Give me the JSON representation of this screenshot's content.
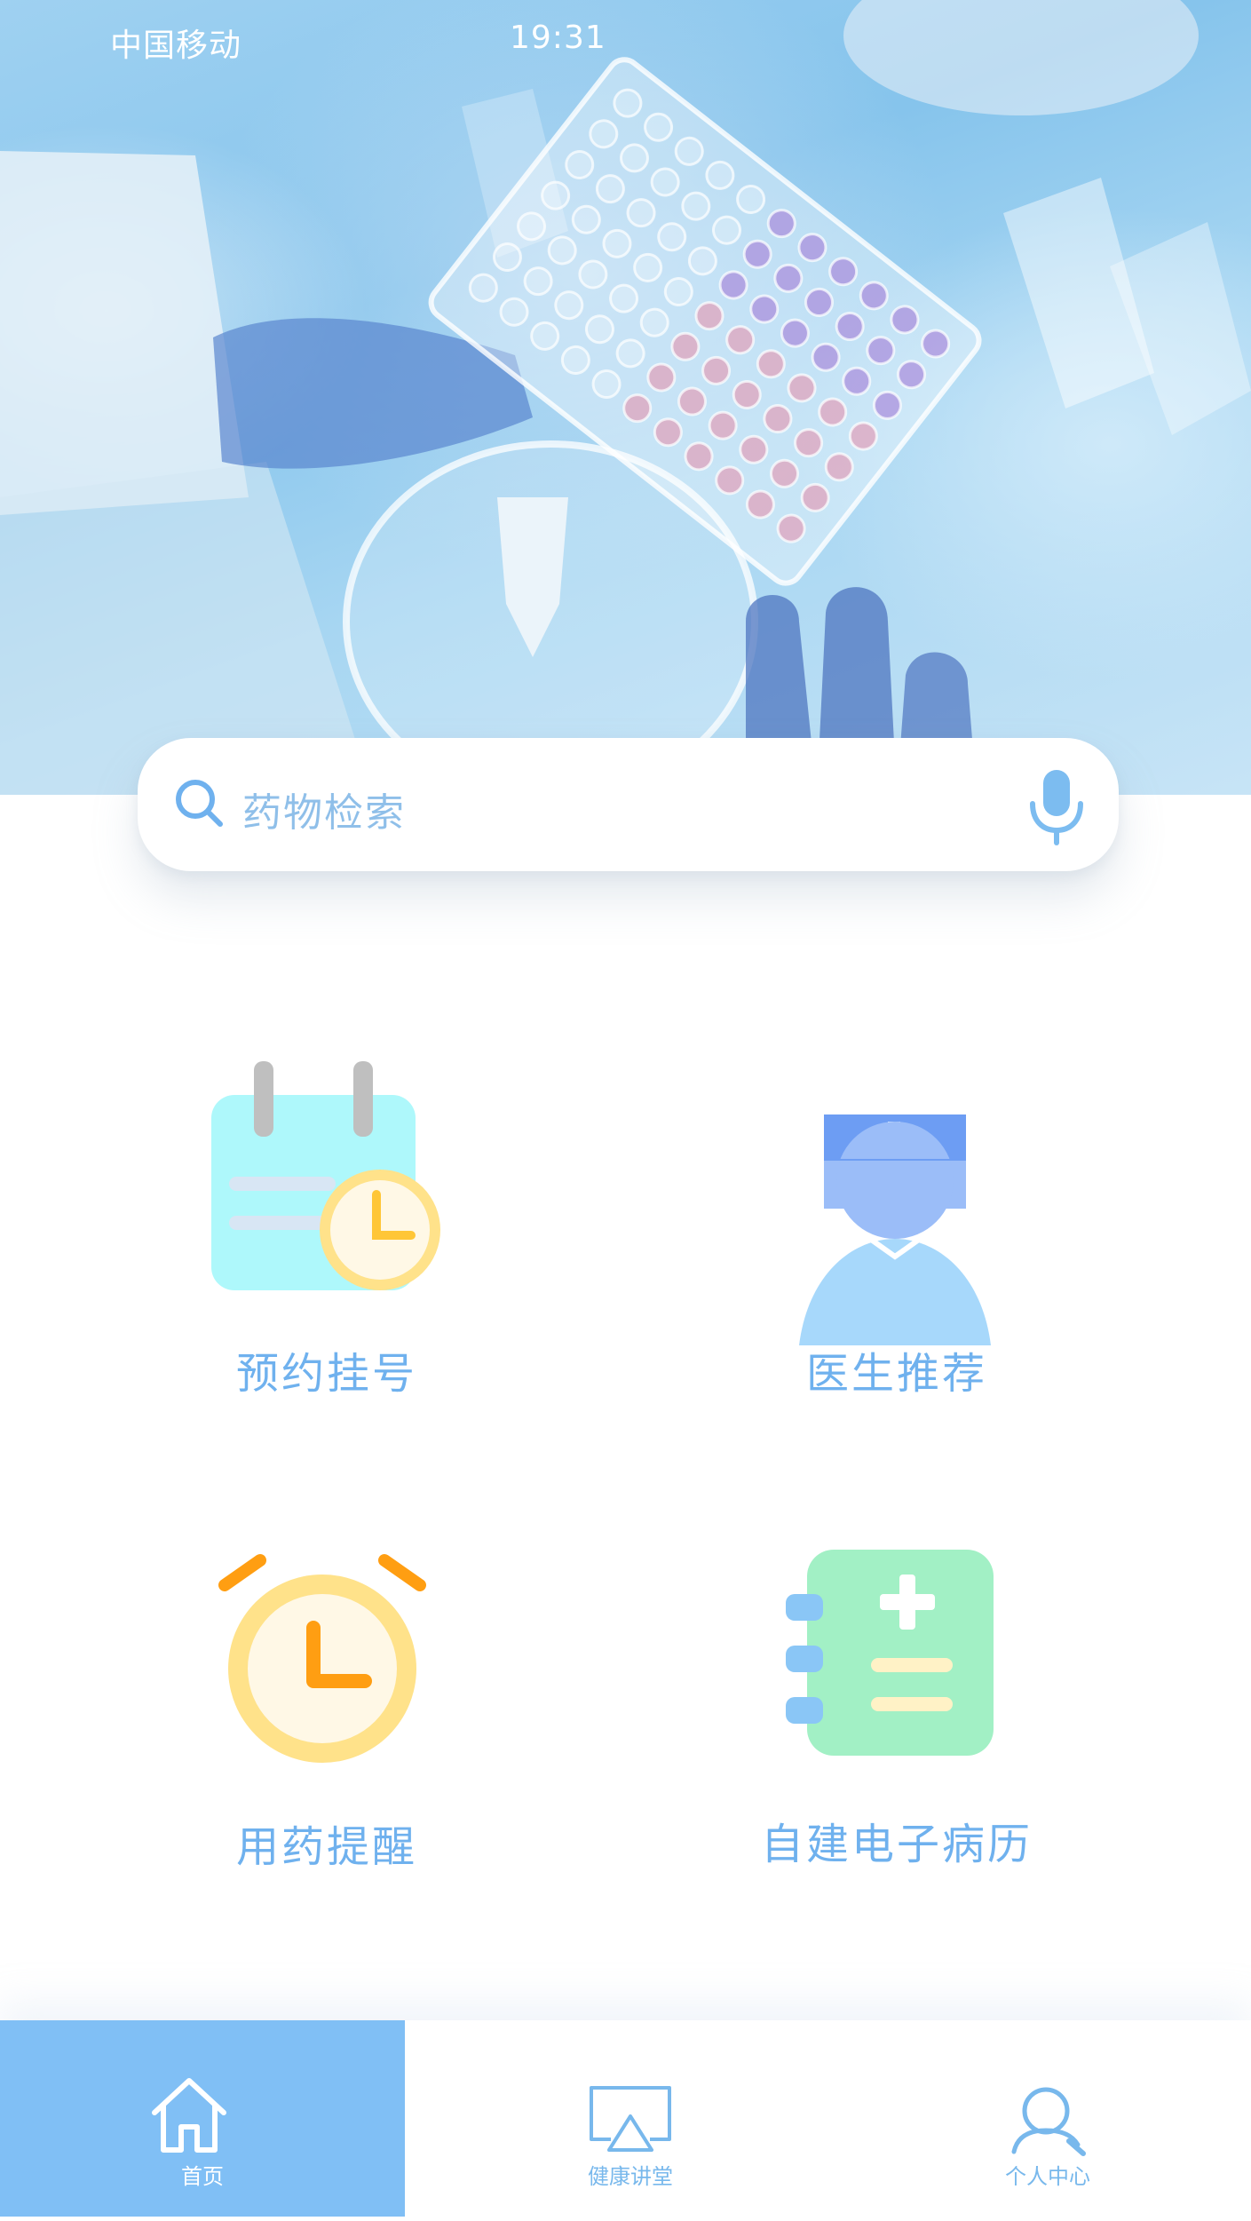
{
  "status_bar": {
    "carrier": "中国移动",
    "time": "19:31"
  },
  "search": {
    "placeholder": "药物检索",
    "icon": "search-icon",
    "mic_icon": "microphone-icon"
  },
  "features": [
    {
      "label": "预约挂号",
      "icon": "calendar-clock-icon"
    },
    {
      "label": "医生推荐",
      "icon": "doctor-icon"
    },
    {
      "label": "用药提醒",
      "icon": "alarm-clock-icon"
    },
    {
      "label": "自建电子病历",
      "icon": "medical-record-icon"
    }
  ],
  "tabbar": {
    "items": [
      {
        "label": "首页",
        "icon": "home-icon",
        "active": true
      },
      {
        "label": "健康讲堂",
        "icon": "screen-cast-icon",
        "active": false
      },
      {
        "label": "个人中心",
        "icon": "user-icon",
        "active": false
      }
    ]
  },
  "colors": {
    "accent": "#80bff5",
    "label": "#6fb1ee",
    "placeholder": "#8fbfe9"
  }
}
